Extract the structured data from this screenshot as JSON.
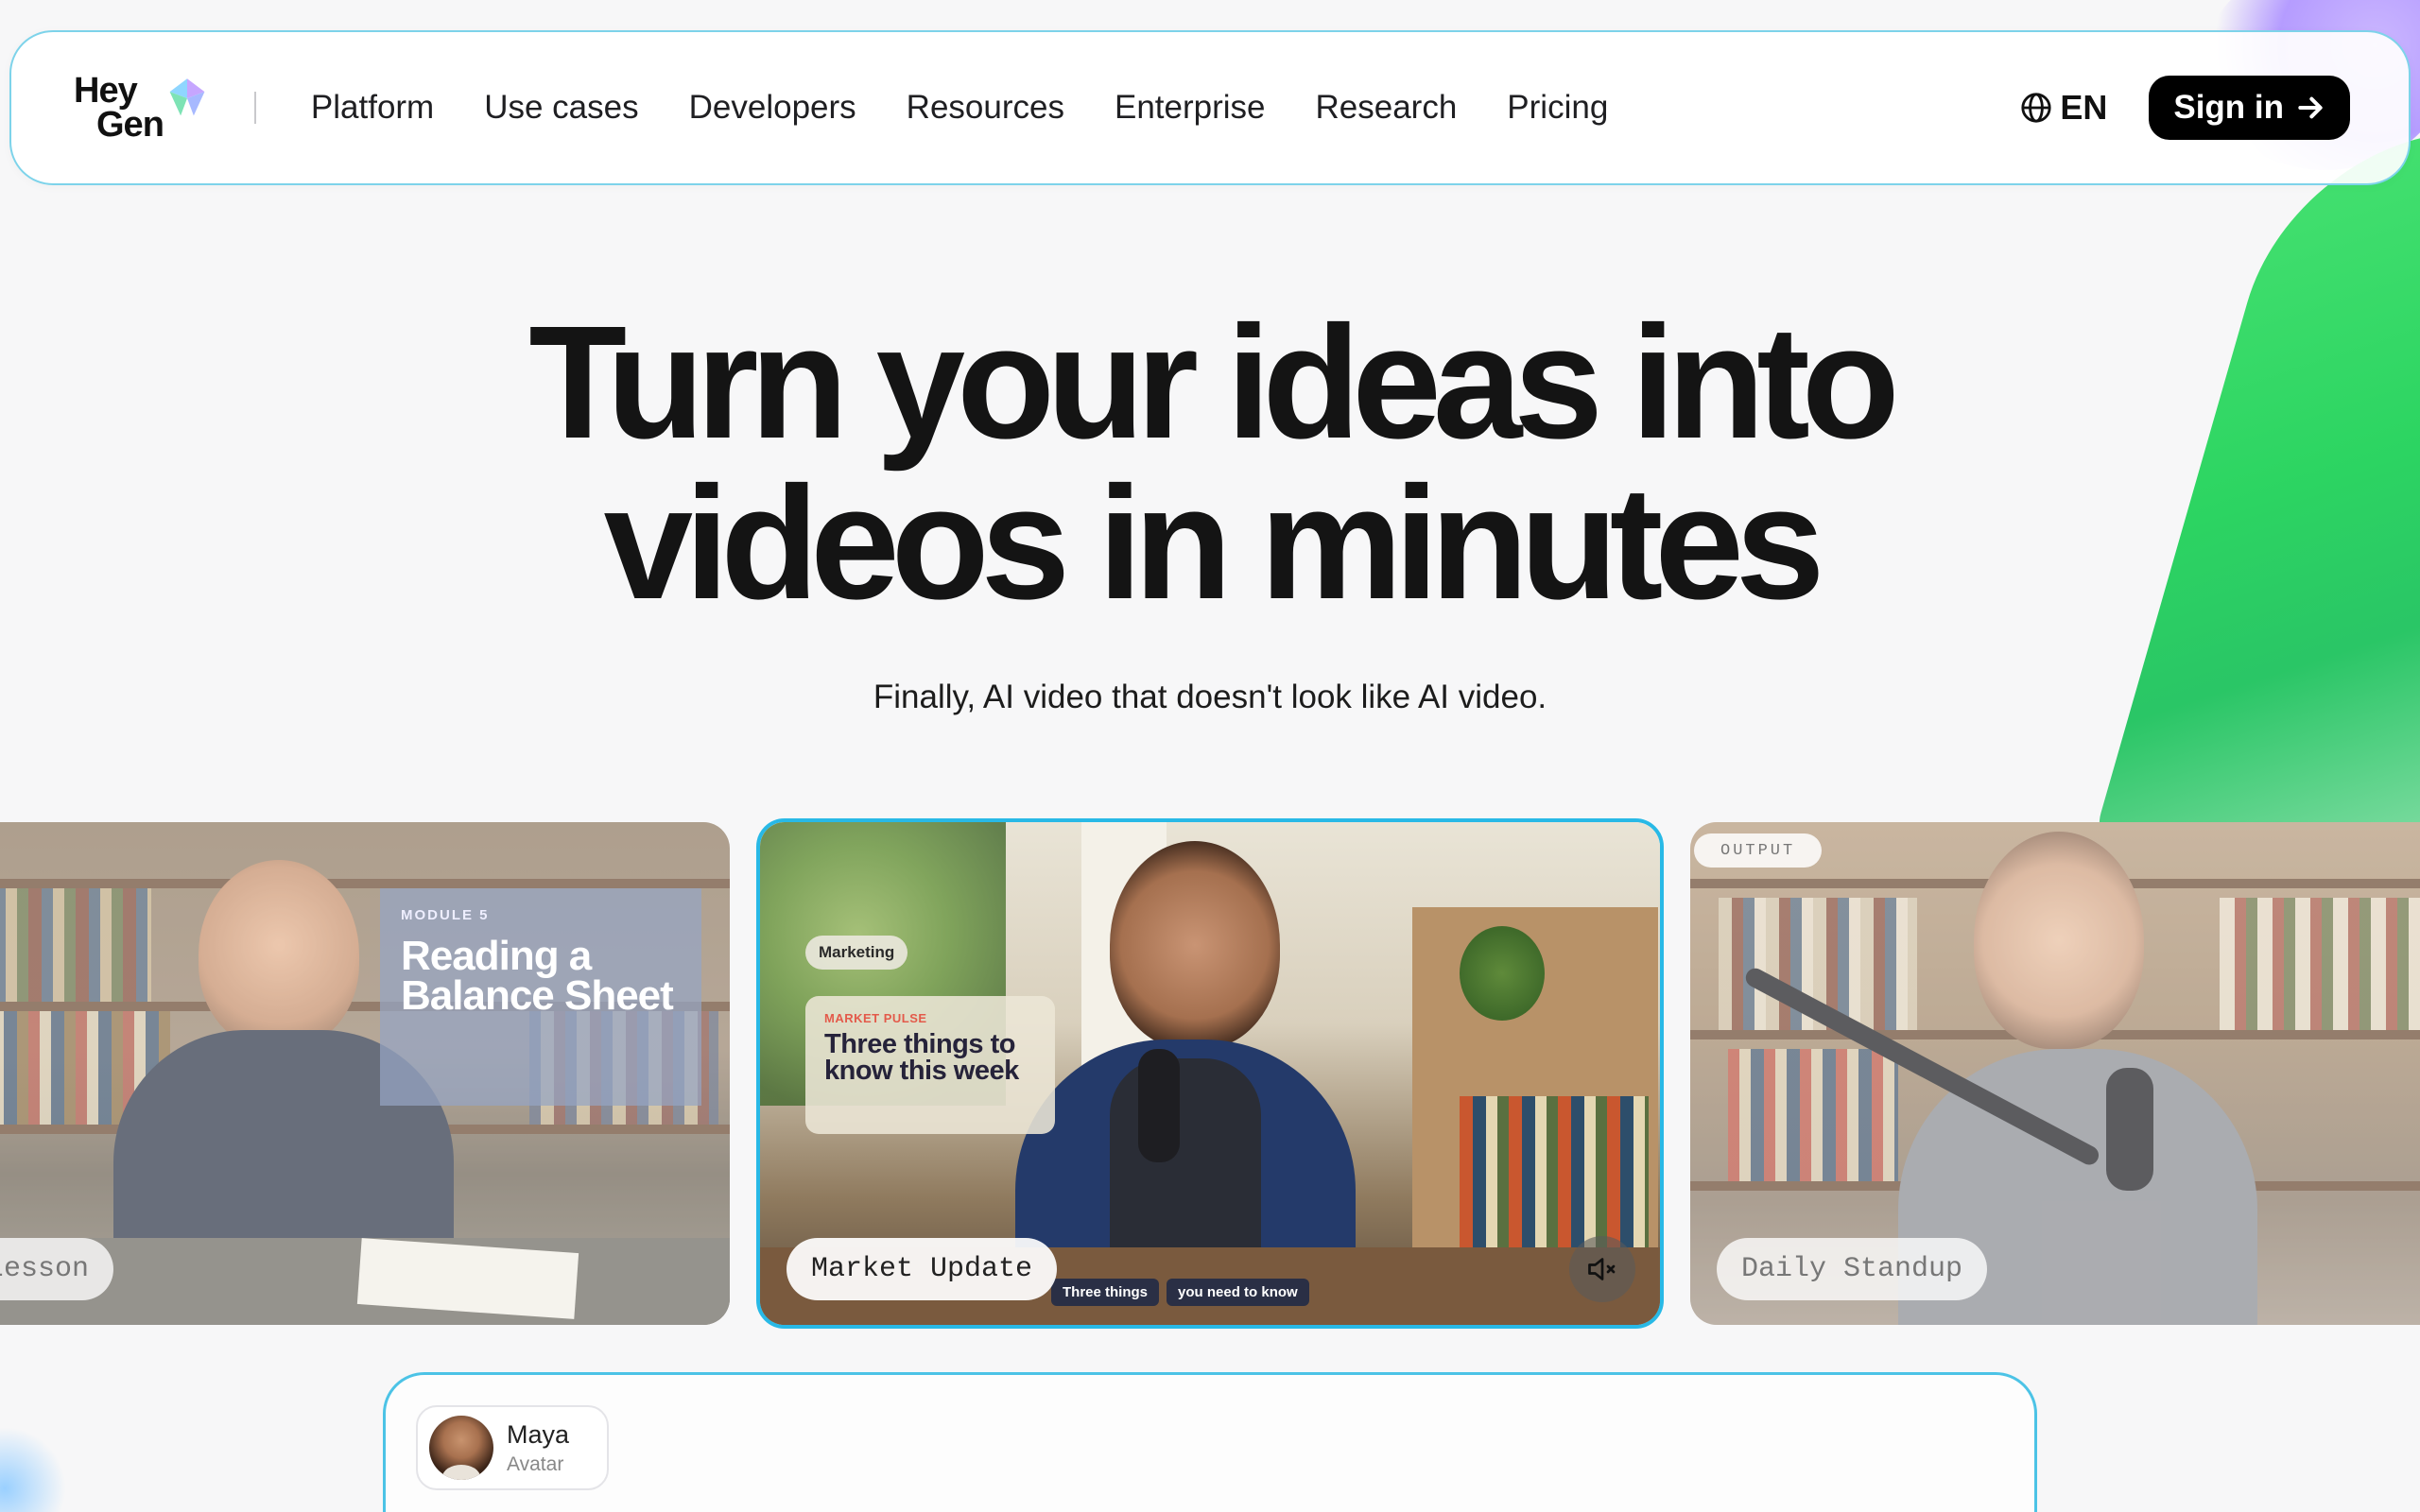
{
  "brand": {
    "line1": "Hey",
    "line2": "Gen"
  },
  "nav": {
    "links": [
      "Platform",
      "Use cases",
      "Developers",
      "Resources",
      "Enterprise",
      "Research",
      "Pricing"
    ],
    "language": "EN",
    "signin_label": "Sign in"
  },
  "hero": {
    "title_line1": "Turn your ideas into",
    "title_line2": "videos in minutes",
    "subtitle": "Finally, AI video that doesn't look like AI video."
  },
  "cards": {
    "left": {
      "module": "MODULE 5",
      "overlay_title": "Reading a Balance Sheet",
      "label": "Lesson"
    },
    "center": {
      "tag": "Marketing",
      "kicker": "MARKET PULSE",
      "headline": "Three things to know this week",
      "captions": [
        "Three things",
        "you need to know"
      ],
      "label": "Market Update",
      "mute_icon": "speaker-muted-icon"
    },
    "right": {
      "badge": "OUTPUT",
      "label": "Daily Standup"
    }
  },
  "composer": {
    "avatar_name": "Maya",
    "avatar_role": "Avatar"
  },
  "colors": {
    "accent_border": "#28b9e6",
    "green_blob": "#22d35a",
    "purple_blob": "#b59cff",
    "signin_bg": "#000000"
  }
}
